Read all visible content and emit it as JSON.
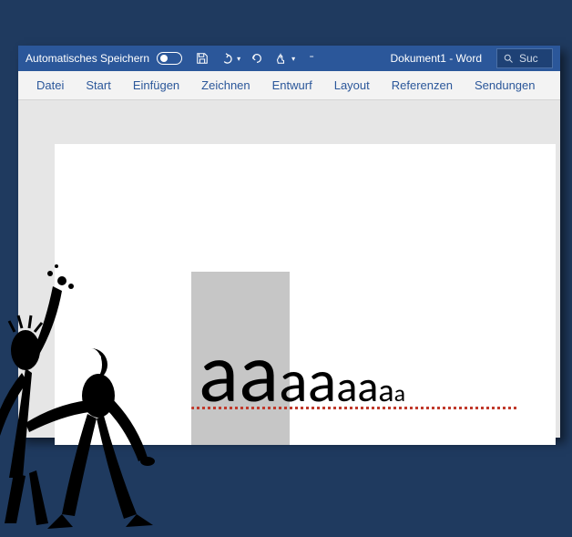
{
  "title_bar": {
    "autosave_label": "Automatisches Speichern",
    "doc_title": "Dokument1  -  Word",
    "search_placeholder": "Suc"
  },
  "ribbon": {
    "tabs": [
      "Datei",
      "Start",
      "Einfügen",
      "Zeichnen",
      "Entwurf",
      "Layout",
      "Referenzen",
      "Sendungen"
    ]
  },
  "document": {
    "chars": [
      {
        "t": "a",
        "size": 92
      },
      {
        "t": "a",
        "size": 92
      },
      {
        "t": "a",
        "size": 66
      },
      {
        "t": "a",
        "size": 66
      },
      {
        "t": "a",
        "size": 48
      },
      {
        "t": "a",
        "size": 48
      },
      {
        "t": "a",
        "size": 36
      },
      {
        "t": "a",
        "size": 26
      }
    ]
  },
  "icons": {
    "save": "save-icon",
    "undo": "undo-icon",
    "redo": "redo-icon",
    "touch": "touch-icon",
    "more": "more-icon",
    "search": "search-icon"
  }
}
